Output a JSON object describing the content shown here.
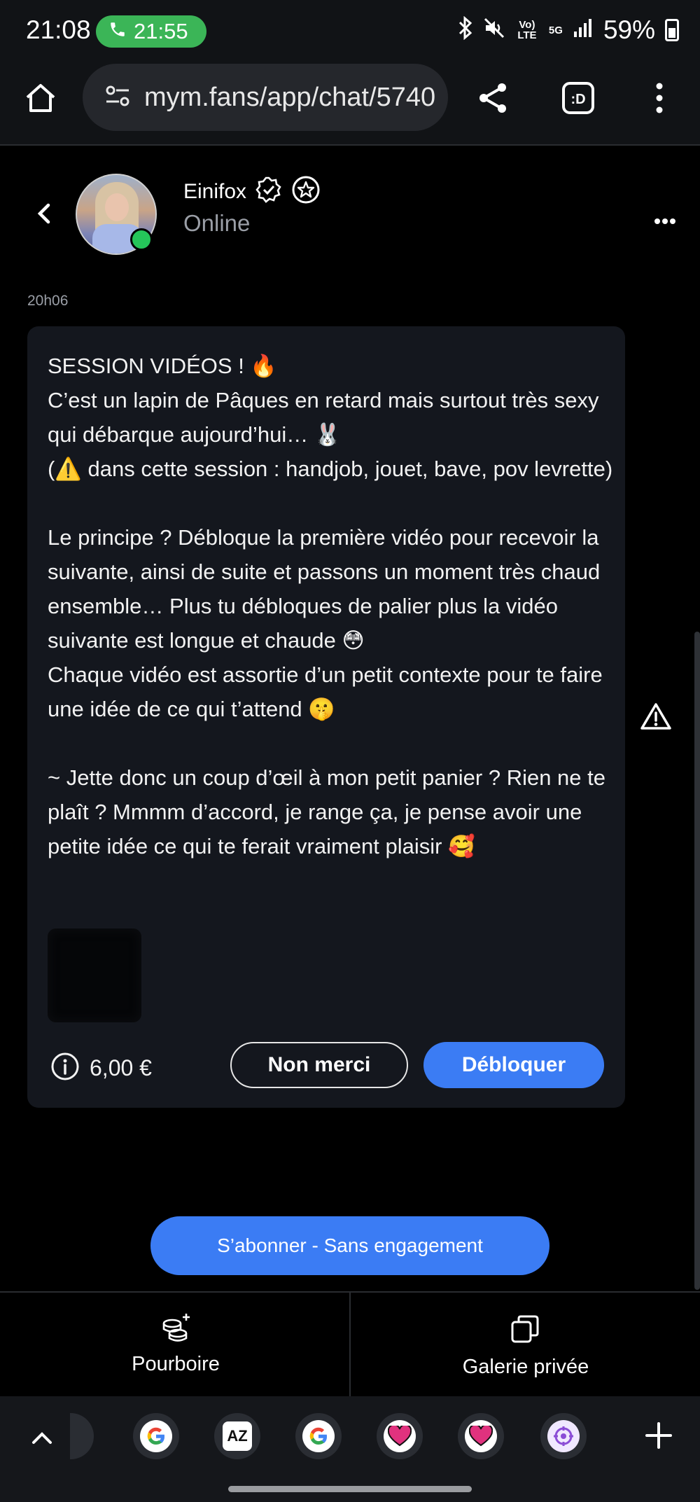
{
  "status_bar": {
    "time": "21:08",
    "call_timer": "21:55",
    "network_label": "Vo) LTE",
    "network_5g": "5G",
    "battery": "59%",
    "call_color": "#3bb557"
  },
  "browser": {
    "url": "mym.fans/app/chat/5740"
  },
  "chat_header": {
    "name": "Einifox",
    "status": "Online",
    "online_color": "#25c55a"
  },
  "messages": {
    "timestamp": "20h06",
    "body": "SESSION VIDÉOS ! 🔥\nC’est un lapin de Pâques en retard mais surtout très sexy qui débarque aujourd’hui… 🐰\n(⚠️ dans cette session : handjob, jouet, bave, pov levrette)\n\nLe principe ? Débloque la première vidéo pour recevoir la suivante, ainsi de suite et passons un moment très chaud ensemble… Plus tu débloques de palier plus la vidéo suivante est longue et chaude 😳\nChaque vidéo est assortie d’un petit contexte pour te faire une idée de ce qui t’attend 🤫\n\n~ Jette donc un coup d’œil à mon petit panier ? Rien ne te plaît ? Mmmm d’accord, je range ça, je pense avoir une petite idée ce qui te ferait vraiment plaisir 🥰",
    "price": "6,00 €",
    "decline_label": "Non merci",
    "unlock_label": "Débloquer",
    "accent_color": "#3b7cf4"
  },
  "subscribe": {
    "label": "S’abonner - Sans engagement"
  },
  "actions": {
    "tip_label": "Pourboire",
    "gallery_label": "Galerie privée"
  },
  "nav": {
    "apps": [
      "google-icon",
      "az-icon",
      "google-icon",
      "heart-app-icon",
      "heart-app-icon",
      "settings-app-icon"
    ]
  }
}
